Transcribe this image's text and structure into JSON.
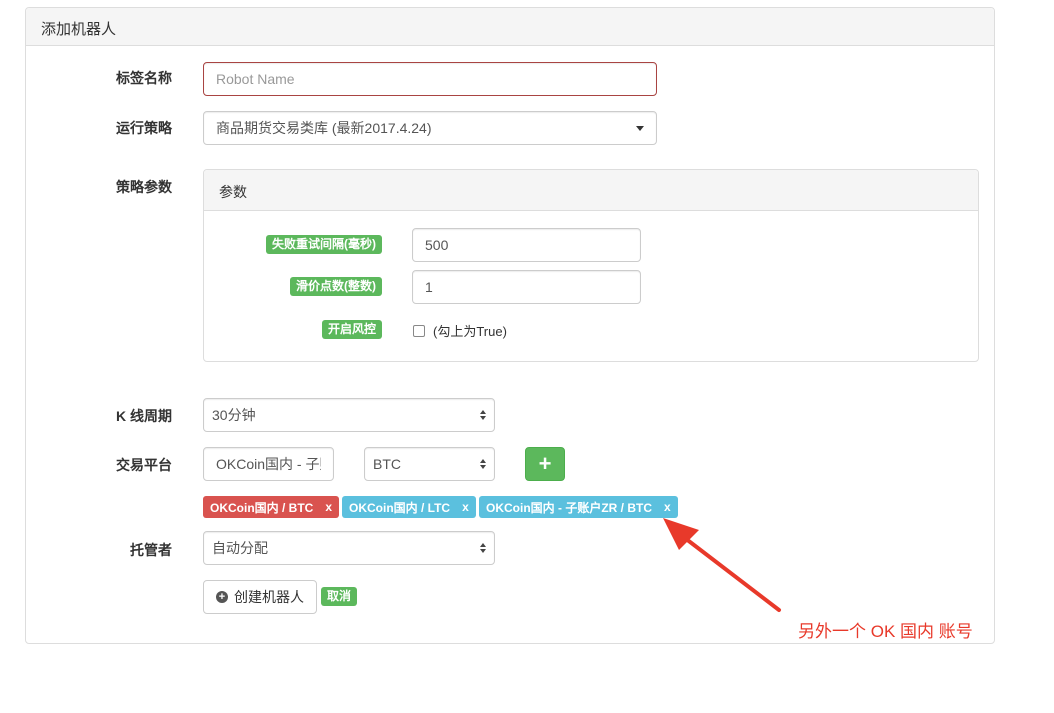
{
  "panel": {
    "title": "添加机器人"
  },
  "form": {
    "tag_name": {
      "label": "标签名称",
      "placeholder": "Robot Name"
    },
    "strategy": {
      "label": "运行策略",
      "selected": "商品期货交易类库 (最新2017.4.24)"
    },
    "params": {
      "label": "策略参数",
      "panel_title": "参数",
      "items": [
        {
          "name": "失败重试间隔(毫秒)",
          "value": "500"
        },
        {
          "name": "滑价点数(整数)",
          "value": "1"
        },
        {
          "name": "开启风控",
          "checkbox_label": "(勾上为True)",
          "checked": false
        }
      ]
    },
    "kline": {
      "label": "K 线周期",
      "selected": "30分钟"
    },
    "exchange": {
      "label": "交易平台",
      "platform_selected": "OKCoin国内 - 子账户ZR",
      "pair_selected": "BTC",
      "add_button": "+",
      "tags": [
        {
          "text": "OKCoin国内 / BTC",
          "close": "x",
          "color": "#d9534f"
        },
        {
          "text": "OKCoin国内 / LTC",
          "close": "x",
          "color": "#5bc0de"
        },
        {
          "text": "OKCoin国内 - 子账户ZR / BTC",
          "close": "x",
          "color": "#5bc0de"
        }
      ]
    },
    "host": {
      "label": "托管者",
      "selected": "自动分配"
    },
    "actions": {
      "create": "创建机器人",
      "cancel": "取消"
    }
  },
  "annotation": {
    "text": "另外一个 OK 国内 账号",
    "color": "#e8392a"
  }
}
